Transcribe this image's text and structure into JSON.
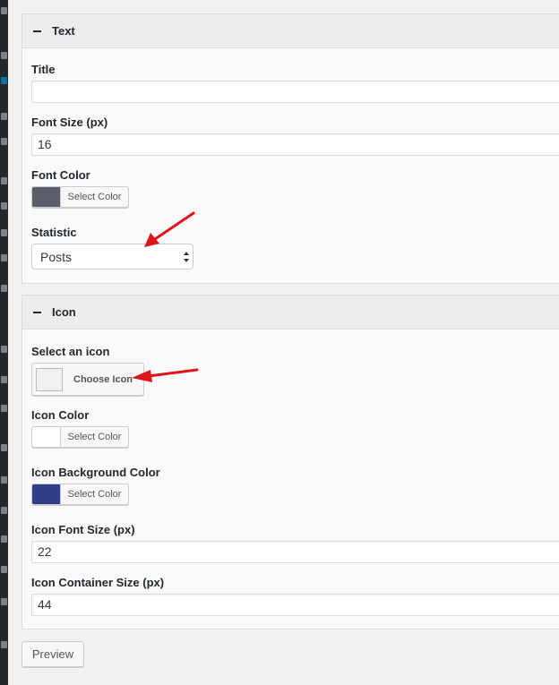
{
  "text_section": {
    "header": "Text",
    "title_label": "Title",
    "title_value": "",
    "font_size_label": "Font Size (px)",
    "font_size_value": "16",
    "font_color_label": "Font Color",
    "font_color_swatch": "#5b5e6b",
    "font_color_button": "Select Color",
    "statistic_label": "Statistic",
    "statistic_selected": "Posts"
  },
  "icon_section": {
    "header": "Icon",
    "select_icon_label": "Select an icon",
    "choose_icon_button": "Choose Icon",
    "icon_color_label": "Icon Color",
    "icon_color_swatch": "#ffffff",
    "icon_color_button": "Select Color",
    "icon_bg_color_label": "Icon Background Color",
    "icon_bg_color_swatch": "#2f3e8a",
    "icon_bg_color_button": "Select Color",
    "icon_font_size_label": "Icon Font Size (px)",
    "icon_font_size_value": "22",
    "icon_container_size_label": "Icon Container Size (px)",
    "icon_container_size_value": "44"
  },
  "preview_button": "Preview",
  "annotation_color": "#e0141b"
}
